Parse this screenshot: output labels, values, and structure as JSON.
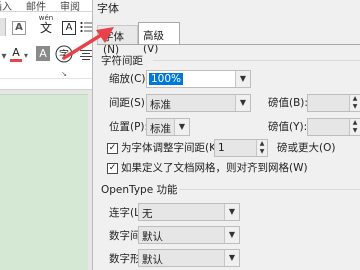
{
  "ribbon": {
    "tabs": [
      "插入",
      "邮件",
      "审阅"
    ],
    "phonetic_ruby": "wén",
    "phonetic_char": "文",
    "char_border": "A",
    "font_color_letter": "A",
    "char_shade_letter": "A",
    "small_mark": "A"
  },
  "dialog": {
    "title": "字体",
    "tabs": {
      "font": "字体(N)",
      "advanced": "高级(V)"
    },
    "char_spacing": {
      "section": "字符间距",
      "scale_label": "缩放(C):",
      "scale_value": "100%",
      "spacing_label": "间距(S):",
      "spacing_value": "标准",
      "spacing_by_label": "磅值(B):",
      "spacing_by_value": "",
      "position_label": "位置(P):",
      "position_value": "标准",
      "position_by_label": "磅值(Y):",
      "position_by_value": "",
      "kerning_label": "为字体调整字间距(K):",
      "kerning_checked": true,
      "kerning_value": "1",
      "kerning_suffix": "磅或更大(O)",
      "grid_label": "如果定义了文档网格，则对齐到网格(W)",
      "grid_checked": true
    },
    "opentype": {
      "section": "OpenType 功能",
      "ligatures_label": "连字(L):",
      "ligatures_value": "无",
      "num_spacing_label": "数字间距(M):",
      "num_spacing_value": "默认",
      "num_form_label": "数字形式(F):",
      "num_form_value": "默认"
    }
  },
  "colors": {
    "accent_arrow": "#e8414a",
    "highlight": "#0078d7",
    "document_bg": "#d4e8d4"
  }
}
